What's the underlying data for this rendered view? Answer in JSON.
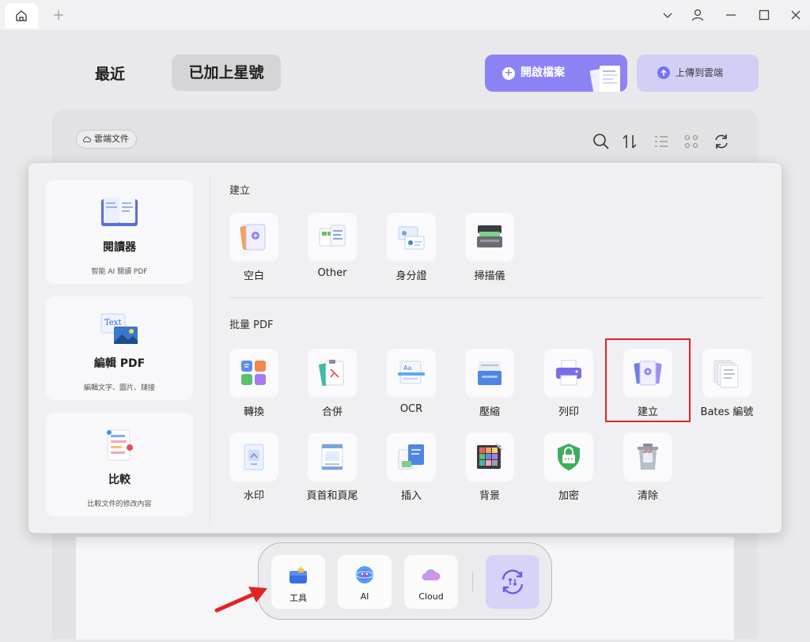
{
  "titlebar": {
    "home_icon": "home-icon",
    "new_tab_icon": "plus-icon",
    "controls": [
      "chevron-down-icon",
      "user-icon",
      "minimize-icon",
      "maximize-icon",
      "close-icon"
    ]
  },
  "header": {
    "recent_label": "最近",
    "starred_label": "已加上星號",
    "open_file_label": "開啟檔案",
    "upload_cloud_label": "上傳到雲端"
  },
  "files": {
    "cloud_docs_label": "雲端文件",
    "toolbar_icons": [
      "search-icon",
      "sort-icon",
      "list-view-icon",
      "grid-view-icon",
      "refresh-icon"
    ]
  },
  "popup": {
    "left_cards": [
      {
        "title": "閱讀器",
        "subtitle": "智能 AI 閱讀 PDF"
      },
      {
        "title": "編輯 PDF",
        "subtitle": "編輯文字、圖片、鏈接",
        "image_text": "Text"
      },
      {
        "title": "比較",
        "subtitle": "比較文件的修改內容"
      }
    ],
    "create_section": {
      "title": "建立",
      "items": [
        {
          "label": "空白",
          "icon": "blank-doc-icon"
        },
        {
          "label": "Other",
          "icon": "other-docs-icon"
        },
        {
          "label": "身分證",
          "icon": "id-card-icon"
        },
        {
          "label": "掃描儀",
          "icon": "scanner-icon"
        }
      ]
    },
    "batch_section": {
      "title": "批量 PDF",
      "items": [
        {
          "label": "轉換",
          "icon": "convert-icon"
        },
        {
          "label": "合併",
          "icon": "merge-icon"
        },
        {
          "label": "OCR",
          "icon": "ocr-icon"
        },
        {
          "label": "壓縮",
          "icon": "compress-icon"
        },
        {
          "label": "列印",
          "icon": "print-icon"
        },
        {
          "label": "建立",
          "icon": "create-pdf-icon"
        },
        {
          "label": "Bates 編號",
          "icon": "bates-numbering-icon"
        },
        {
          "label": "水印",
          "icon": "watermark-icon"
        },
        {
          "label": "頁首和頁尾",
          "icon": "header-footer-icon"
        },
        {
          "label": "插入",
          "icon": "insert-icon"
        },
        {
          "label": "背景",
          "icon": "background-icon"
        },
        {
          "label": "加密",
          "icon": "encrypt-icon"
        },
        {
          "label": "清除",
          "icon": "clear-icon"
        }
      ]
    }
  },
  "dock": {
    "tools_label": "工具",
    "ai_label": "AI",
    "cloud_label": "Cloud"
  },
  "colors": {
    "accent": "#8c82f3",
    "highlight_box": "#e02424",
    "arrow": "#e02424"
  }
}
